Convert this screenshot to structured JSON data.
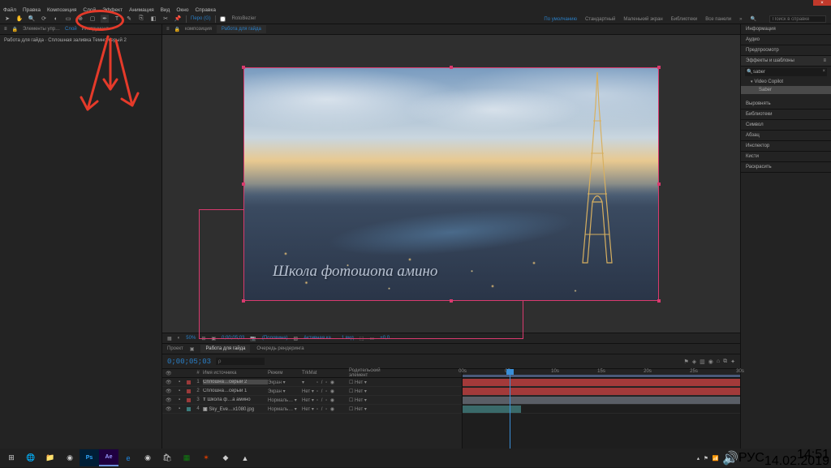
{
  "titlebar": {
    "close": "×"
  },
  "menu": [
    "Файл",
    "Правка",
    "Композиция",
    "Слой",
    "Эффект",
    "Анимация",
    "Вид",
    "Окно",
    "Справка"
  ],
  "toolbar": {
    "rotobezier": "RotoBezier",
    "fill_label": "",
    "pen_label": "Перо (G)"
  },
  "workspaces": {
    "items": [
      "По умолчанию",
      "Стандартный",
      "Маленький экран",
      "Библиотеки",
      "Все панели"
    ],
    "search_placeholder": "Поиск в справке"
  },
  "left_panel": {
    "tabs": [
      "Элементы упр…",
      "Слой",
      "Инструмент"
    ],
    "body": "Работа для гайда · Сплошная заливка Темно-серый 2"
  },
  "comp": {
    "prefix": "композиция",
    "tab": "Работа для гайда",
    "canvas_text": "Школа фотошопа амино"
  },
  "viewer_bar": {
    "zoom": "50%",
    "res": "(Половина)",
    "time": "0;00;05;03",
    "view": "Активная ка…",
    "views": "1 вид",
    "exp": "+0,0"
  },
  "timeline": {
    "tabs": [
      "Проект",
      "Работа для гайда",
      "Очередь рендеринга"
    ],
    "timecode": "0;00;05;03",
    "search_placeholder": "ρ",
    "columns": {
      "src": "Имя источника",
      "mode": "Режим",
      "trk": "TrkMat",
      "parent": "Родительский элемент"
    },
    "layers": [
      {
        "num": "1",
        "color": "#9a3a3a",
        "name": "Сплошна…серый 2",
        "mode": "Экран",
        "trk": "",
        "parent": "Нет",
        "sel": true
      },
      {
        "num": "2",
        "color": "#9a3a3a",
        "name": "Сплошна…серый 1",
        "mode": "Экран",
        "trk": "Нет",
        "parent": "Нет"
      },
      {
        "num": "3",
        "color": "#9a3a3a",
        "name": "Школа ф…а амино",
        "mode": "Нормаль…",
        "trk": "Нет",
        "parent": "Нет",
        "icon": "T"
      },
      {
        "num": "4",
        "color": "#3a7a7a",
        "name": "Sky_Eve…x1080.jpg",
        "mode": "Нормаль…",
        "trk": "Нет",
        "parent": "Нет",
        "icon": "▣"
      }
    ],
    "ruler": [
      "00s",
      "05s",
      "10s",
      "15s",
      "20s",
      "25s",
      "30s"
    ]
  },
  "right_panel": {
    "sections": [
      "Информация",
      "Аудио",
      "Предпросмотр"
    ],
    "effects_head": "Эффекты и шаблоны",
    "search_value": "saber",
    "group": "Video Copilot",
    "item": "Saber",
    "rest": [
      "Выровнять",
      "Библиотеки",
      "Символ",
      "Абзац",
      "Инспектор",
      "Кисти",
      "Раскрасить"
    ]
  },
  "taskbar": {
    "clock_time": "14:51",
    "clock_date": "14.02.2019",
    "lang": "РУС"
  }
}
